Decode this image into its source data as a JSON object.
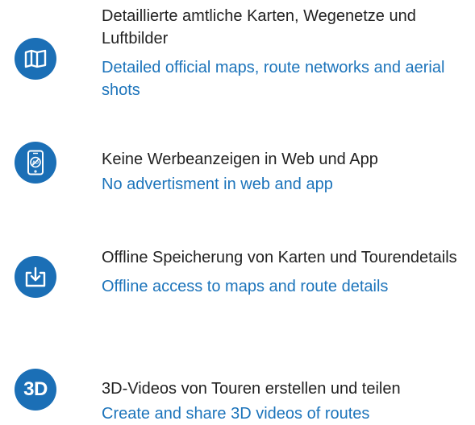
{
  "features": [
    {
      "icon": "map-icon",
      "german": "Detaillierte amtliche Karten, Wegenetze und Luftbilder",
      "english": "Detailed official maps, route networks and aerial shots"
    },
    {
      "icon": "no-ads-phone-icon",
      "german": "Keine Werbeanzeigen in Web und App",
      "english": "No advertisment in web and app"
    },
    {
      "icon": "download-icon",
      "german": "Offline Speicherung von Karten und Tourendetails",
      "english": "Offline access to maps and route details"
    },
    {
      "icon": "3d-icon",
      "icon_text": "3D",
      "german": "3D-Videos von Touren erstellen und teilen",
      "english": "Create and share 3D videos of routes"
    }
  ],
  "colors": {
    "icon_background": "#1b6fb6",
    "german_text": "#222222",
    "english_text": "#1c74bb"
  }
}
